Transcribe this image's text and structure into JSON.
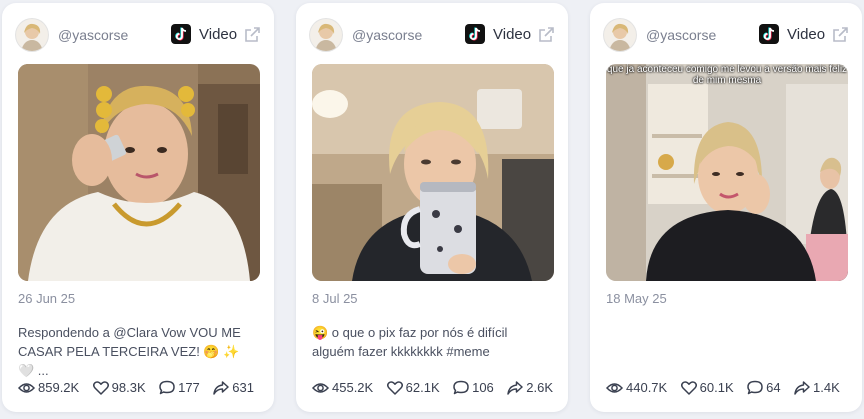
{
  "posts": [
    {
      "handle": "@yascorse",
      "type_label": "Video",
      "platform_icon": "tiktok-icon",
      "overlay_text": "",
      "date": "26 Jun 25",
      "caption": "Respondendo a @Clara Vow VOU ME CASAR PELA TERCEIRA VEZ! 🤭 ✨ 🤍 ...",
      "stats": {
        "views": "859.2K",
        "likes": "98.3K",
        "comments": "177",
        "shares": "631"
      }
    },
    {
      "handle": "@yascorse",
      "type_label": "Video",
      "platform_icon": "tiktok-icon",
      "overlay_text": "",
      "date": "8 Jul 25",
      "caption": "😜 o que o pix faz por nós é difícil alguém fazer kkkkkkkk #meme",
      "stats": {
        "views": "455.2K",
        "likes": "62.1K",
        "comments": "106",
        "shares": "2.6K"
      }
    },
    {
      "handle": "@yascorse",
      "type_label": "Video",
      "platform_icon": "tiktok-icon",
      "overlay_text": "que ja aconteceu comigo me levou a versão mais feliz de mim mesma",
      "date": "18 May 25",
      "caption": "",
      "stats": {
        "views": "440.7K",
        "likes": "60.1K",
        "comments": "64",
        "shares": "1.4K"
      }
    }
  ],
  "colors": {
    "background": "#eef0f5",
    "card": "#ffffff",
    "muted_text": "#8b90a0",
    "stat_text": "#3a4050"
  }
}
